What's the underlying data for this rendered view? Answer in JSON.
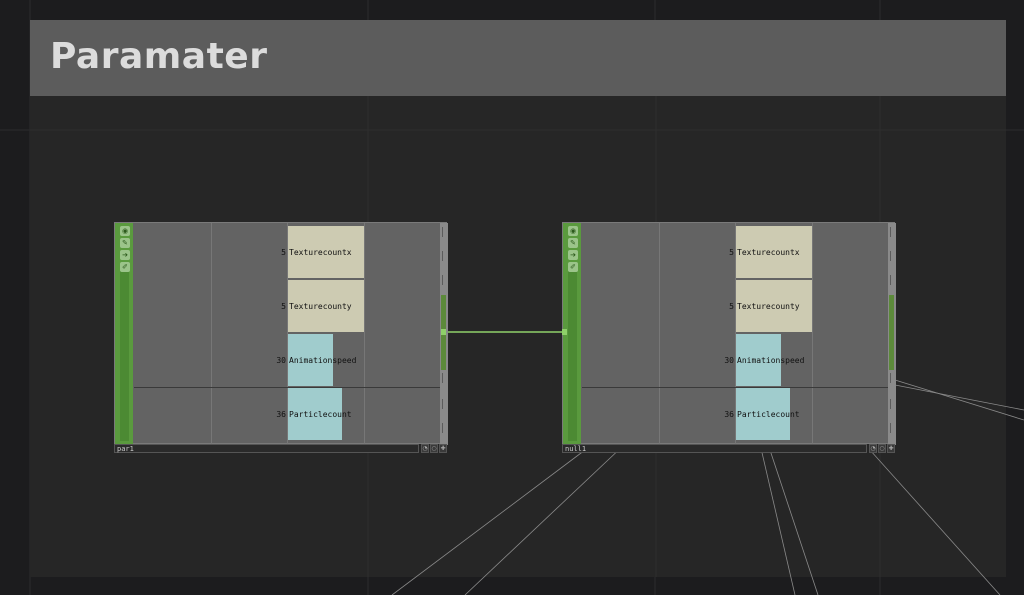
{
  "page": {
    "title": "Paramater"
  },
  "colors": {
    "background": "#1c1c1e",
    "panel": "#262626",
    "title_bar": "#5c5c5c",
    "node_body": "#636363",
    "node_accent": "#5a9a3e",
    "bar_int": "#cdcbb2",
    "bar_float": "#a0cccd",
    "wire": "#8fd06a"
  },
  "nodes": [
    {
      "name": "par1",
      "channels": [
        {
          "value": "5",
          "label": "Texturecountx"
        },
        {
          "value": "5",
          "label": "Texturecounty"
        },
        {
          "value": "30",
          "label": "Animationspeed"
        },
        {
          "value": "36",
          "label": "Particlecount"
        }
      ]
    },
    {
      "name": "null1",
      "channels": [
        {
          "value": "5",
          "label": "Texturecountx"
        },
        {
          "value": "5",
          "label": "Texturecounty"
        },
        {
          "value": "30",
          "label": "Animationspeed"
        },
        {
          "value": "36",
          "label": "Particlecount"
        }
      ]
    }
  ],
  "icons": {
    "flag_1": "viewer-icon",
    "flag_2": "edit-icon",
    "flag_3": "bypass-icon",
    "flag_4": "lock-icon"
  }
}
